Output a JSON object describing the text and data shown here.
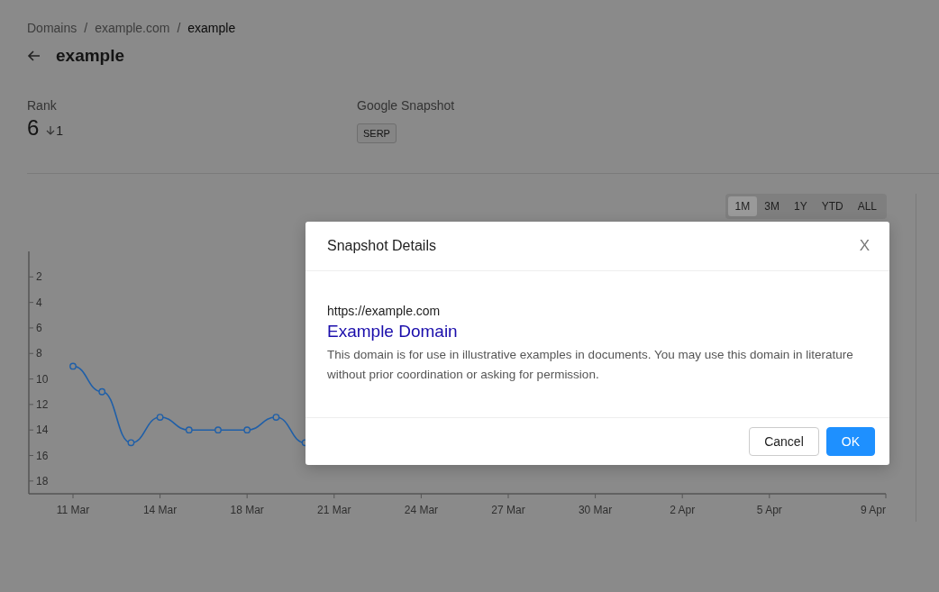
{
  "breadcrumb": [
    {
      "label": "Domains",
      "current": false
    },
    {
      "separator": "/"
    },
    {
      "label": "example.com",
      "current": false
    },
    {
      "separator": "/"
    },
    {
      "label": "example",
      "current": true
    }
  ],
  "title": "example",
  "stats": {
    "rank": {
      "label": "Rank",
      "value": "6",
      "change": "1",
      "declined": true
    },
    "snapshot": {
      "label": "Google Snapshot",
      "badge": "SERP"
    }
  },
  "range_buttons": [
    {
      "label": "1M",
      "selected": true
    },
    {
      "label": "3M",
      "selected": false
    },
    {
      "label": "1Y",
      "selected": false
    },
    {
      "label": "YTD",
      "selected": false
    },
    {
      "label": "ALL",
      "selected": false
    }
  ],
  "chart": {
    "chart_data": {
      "type": "line",
      "categories": [
        "11 Mar",
        null,
        null,
        "14 Mar",
        null,
        null,
        "18 Mar",
        null,
        null,
        "21 Mar",
        null,
        null,
        "24 Mar",
        null,
        null,
        "27 Mar",
        null,
        null,
        "30 Mar",
        null,
        null,
        "2 Apr",
        null,
        null,
        "5 Apr",
        null,
        null,
        null,
        "9 Apr"
      ],
      "series": [
        {
          "color": "#1f5fa8",
          "marker": "circle",
          "values": [
            9,
            11,
            15,
            13,
            14,
            14,
            14,
            13,
            15,
            null,
            null,
            null,
            null,
            null,
            null,
            null,
            null,
            null,
            null,
            null,
            null,
            null,
            null,
            null,
            null,
            null,
            null,
            null,
            null
          ]
        }
      ],
      "ylim": [
        19,
        0
      ],
      "yticks": [
        2,
        4,
        6,
        8,
        10,
        12,
        14,
        16,
        18
      ]
    }
  },
  "modal": {
    "title": "Snapshot Details",
    "close": "X",
    "url": "https://example.com",
    "result_title": "Example Domain",
    "description": "This domain is for use in illustrative examples in documents. You may use this domain in literature without prior coordination or asking for permission.",
    "buttons": [
      {
        "label": "Cancel",
        "kind": "secondary"
      },
      {
        "label": "OK",
        "kind": "primary"
      }
    ]
  }
}
